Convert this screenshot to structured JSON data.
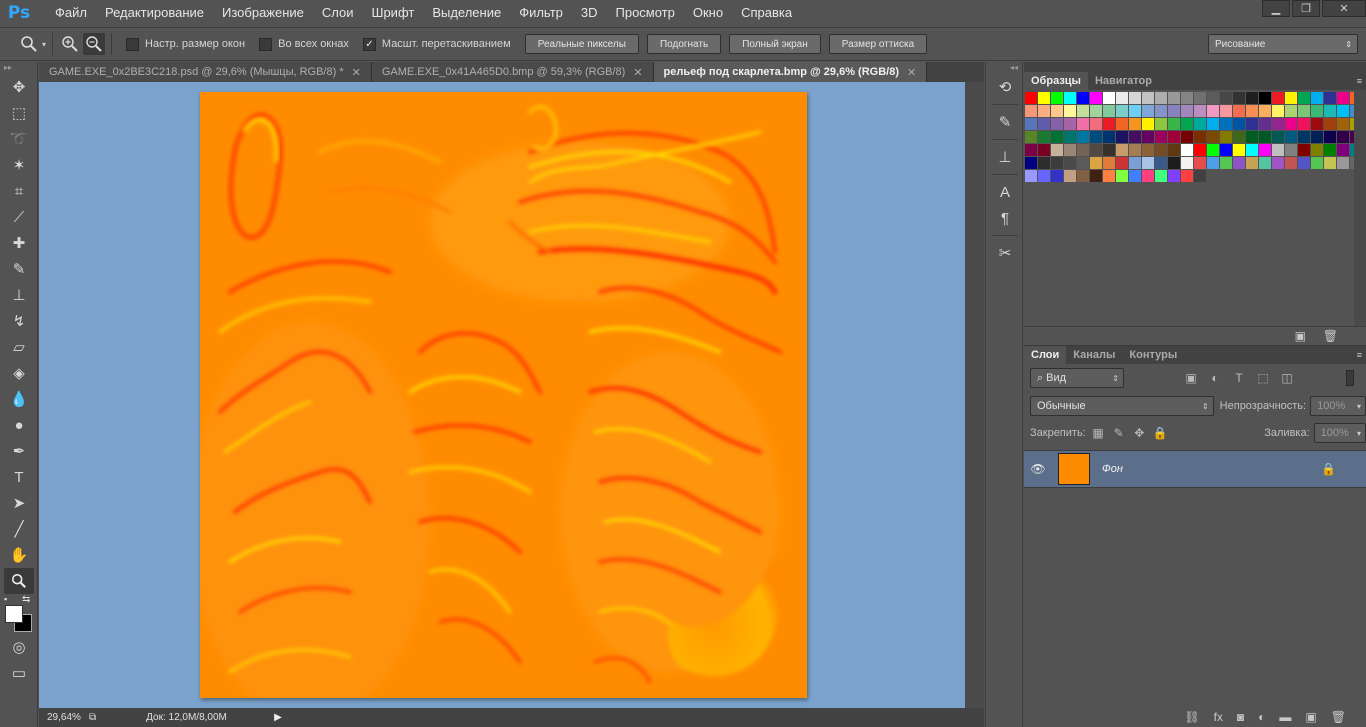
{
  "app": {
    "logo": "Ps"
  },
  "menu": [
    "Файл",
    "Редактирование",
    "Изображение",
    "Слои",
    "Шрифт",
    "Выделение",
    "Фильтр",
    "3D",
    "Просмотр",
    "Окно",
    "Справка"
  ],
  "options": {
    "check1": "Настр. размер окон",
    "check2": "Во всех окнах",
    "check3": "Масшт. перетаскиванием",
    "btn_actual": "Реальные пикселы",
    "btn_fit": "Подогнать",
    "btn_full": "Полный экран",
    "btn_print": "Размер оттиска",
    "workspace": "Рисование"
  },
  "tabs": [
    {
      "title": "GAME.EXE_0x2BE3C218.psd @ 29,6% (Мышцы, RGB/8) *",
      "active": false
    },
    {
      "title": "GAME.EXE_0x41A465D0.bmp @ 59,3% (RGB/8)",
      "active": false
    },
    {
      "title": "рельеф под скарлета.bmp @ 29,6% (RGB/8)",
      "active": true
    }
  ],
  "status": {
    "zoom": "29,64%",
    "doc": "Док: 12,0M/8,00M"
  },
  "swatches_panel": {
    "tab_swatches": "Образцы",
    "tab_navigator": "Навигатор"
  },
  "swatch_colors": [
    "#ff0000",
    "#ffff00",
    "#00ff00",
    "#00ffff",
    "#0000ff",
    "#ff00ff",
    "#ffffff",
    "#ebebeb",
    "#d6d6d6",
    "#c2c2c2",
    "#adadad",
    "#999999",
    "#858585",
    "#707070",
    "#5c5c5c",
    "#474747",
    "#333333",
    "#1f1f1f",
    "#000000",
    "#ed1c24",
    "#fff200",
    "#00a651",
    "#00aeef",
    "#2e3192",
    "#ec008c",
    "#f26522",
    "#f7977a",
    "#f9ad81",
    "#fdc68a",
    "#fff79a",
    "#c4df9b",
    "#a3d39c",
    "#82ca9d",
    "#7bcdc8",
    "#6ecff6",
    "#7ea7d8",
    "#8493ca",
    "#8882be",
    "#a187be",
    "#bc8dbf",
    "#f49ac2",
    "#f6989d",
    "#f26c4f",
    "#f68e55",
    "#fbaf5c",
    "#fff467",
    "#acd372",
    "#7cc576",
    "#3bb878",
    "#1abbb4",
    "#00bff3",
    "#438ccb",
    "#5574b9",
    "#605ca8",
    "#855fa8",
    "#a763a8",
    "#f06eaa",
    "#f26d7d",
    "#ed1c24",
    "#f26522",
    "#f7941d",
    "#fff200",
    "#8dc73f",
    "#39b54a",
    "#00a651",
    "#00a99d",
    "#00aeef",
    "#0072bc",
    "#0054a6",
    "#2e3192",
    "#662d91",
    "#92278f",
    "#ec008c",
    "#ed145b",
    "#9e0b0f",
    "#a0410d",
    "#a36209",
    "#aba000",
    "#598527",
    "#1a7b30",
    "#007236",
    "#00746b",
    "#0076a3",
    "#004b80",
    "#003471",
    "#1b1464",
    "#440e62",
    "#630460",
    "#9e005d",
    "#9e0039",
    "#790000",
    "#7b2e00",
    "#7d4900",
    "#827b00",
    "#406618",
    "#005e20",
    "#005826",
    "#005952",
    "#005b7f",
    "#003663",
    "#002157",
    "#0d004c",
    "#32004b",
    "#4b0049",
    "#7b0046",
    "#7a0026",
    "#c7b299",
    "#998675",
    "#736357",
    "#534741",
    "#37302d",
    "#c69c6d",
    "#a67c52",
    "#8c6239",
    "#754c24",
    "#603913",
    "#ffffff",
    "#ff0000",
    "#00ff00",
    "#0000ff",
    "#ffff00",
    "#00ffff",
    "#ff00ff",
    "#c0c0c0",
    "#808080",
    "#800000",
    "#808000",
    "#008000",
    "#800080",
    "#008080",
    "#000080",
    "#2d2d2d",
    "#3c3c3c",
    "#4b4b4b",
    "#5a5a5a",
    "#d9a441",
    "#e07b39",
    "#cc3333",
    "#7a9fd6",
    "#a8c2e8",
    "#3a5a8c",
    "#1d1d1d",
    "#f2f2f2",
    "#e64c4c",
    "#4c9ee6",
    "#54c454",
    "#8c54c4",
    "#c4a354",
    "#54c4a3",
    "#a354c4",
    "#c45454",
    "#5454c4",
    "#54c454",
    "#c4c454",
    "#999999",
    "#666666",
    "#9999ff",
    "#6666ff",
    "#3333cc",
    "#c0a080",
    "#806040",
    "#402010",
    "#ff8040",
    "#80ff40",
    "#4080ff",
    "#ff4080",
    "#40ff80",
    "#8040ff",
    "#ff4040",
    "#404040"
  ],
  "layers_panel": {
    "tab_layers": "Слои",
    "tab_channels": "Каналы",
    "tab_paths": "Контуры",
    "filter": "Вид",
    "blend": "Обычные",
    "opacity_label": "Непрозрачность:",
    "opacity_value": "100%",
    "lock_label": "Закрепить:",
    "fill_label": "Заливка:",
    "fill_value": "100%",
    "layer_name": "Фон"
  }
}
